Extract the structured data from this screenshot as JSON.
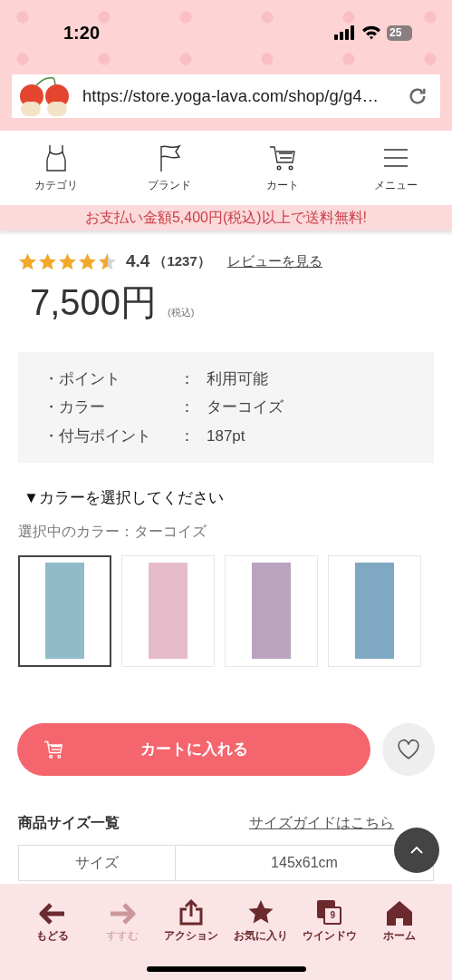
{
  "status_bar": {
    "time": "1:20",
    "battery": "25"
  },
  "browser": {
    "url": "https://store.yoga-lava.com/shop/g/g4…"
  },
  "nav": [
    {
      "kind": "category",
      "label": "カテゴリ"
    },
    {
      "kind": "brand",
      "label": "ブランド"
    },
    {
      "kind": "cart",
      "label": "カート"
    },
    {
      "kind": "menu",
      "label": "メニュー"
    }
  ],
  "promo_banner": "お支払い金額5,400円(税込)以上で送料無料!",
  "rating": {
    "stars": 4.5,
    "score": "4.4",
    "count": "（1237）",
    "review_link": "レビューを見る"
  },
  "price": {
    "amount": "7,500円",
    "tax_note": "(税込)"
  },
  "info": [
    {
      "label": "・ポイント",
      "separator": "：",
      "value": "利用可能"
    },
    {
      "label": "・カラー",
      "separator": "：",
      "value": "ターコイズ"
    },
    {
      "label": "・付与ポイント",
      "separator": "：",
      "value": "187pt"
    }
  ],
  "color_select": {
    "heading": "▼カラーを選択してください",
    "current": "選択中のカラー：ターコイズ",
    "swatches": [
      {
        "selected": true,
        "color": "#8fbcc8"
      },
      {
        "selected": false,
        "color": "#e6bccb"
      },
      {
        "selected": false,
        "color": "#b9a3be"
      },
      {
        "selected": false,
        "color": "#7fa9c2"
      }
    ]
  },
  "add_to_cart": "カートに入れる",
  "favorite": {
    "on": false
  },
  "size_section": {
    "title": "商品サイズ一覧",
    "guide_link": "サイズガイドはこちら",
    "rows": [
      {
        "label": "サイズ",
        "value": "145x61cm"
      }
    ]
  },
  "toolbar": [
    {
      "kind": "back",
      "label": "もどる",
      "disabled": false
    },
    {
      "kind": "forward",
      "label": "すすむ",
      "disabled": true
    },
    {
      "kind": "share",
      "label": "アクション",
      "disabled": false
    },
    {
      "kind": "star",
      "label": "お気に入り",
      "disabled": false
    },
    {
      "kind": "tabs",
      "label": "ウインドウ",
      "disabled": false,
      "badge": "9"
    },
    {
      "kind": "home",
      "label": "ホーム",
      "disabled": false
    }
  ]
}
